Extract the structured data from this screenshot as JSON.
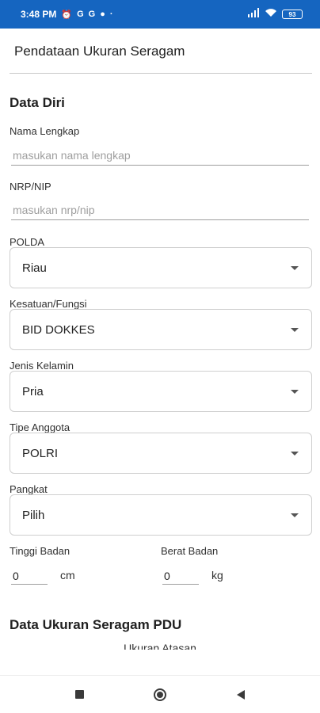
{
  "status_bar": {
    "time": "3:48 PM",
    "notification_icons": [
      "alarm-icon",
      "google-icon",
      "google-icon",
      "app-icon"
    ],
    "notification_glyphs": [
      "⏰",
      "G",
      "G",
      "●"
    ],
    "dot": "·",
    "battery": "93"
  },
  "app_bar": {
    "title": "Pendataan Ukuran Seragam"
  },
  "form": {
    "section_personal": "Data Diri",
    "nama": {
      "label": "Nama Lengkap",
      "placeholder": "masukan nama lengkap",
      "value": ""
    },
    "nrp": {
      "label": "NRP/NIP",
      "placeholder": "masukan nrp/nip",
      "value": ""
    },
    "polda": {
      "label": "POLDA",
      "value": "Riau"
    },
    "kesatuan": {
      "label": "Kesatuan/Fungsi",
      "value": "BID DOKKES"
    },
    "jenis_kelamin": {
      "label": "Jenis Kelamin",
      "value": "Pria"
    },
    "tipe_anggota": {
      "label": "Tipe Anggota",
      "value": "POLRI"
    },
    "pangkat": {
      "label": "Pangkat",
      "value": "Pilih"
    },
    "tinggi": {
      "label": "Tinggi Badan",
      "value": "0",
      "unit": "cm"
    },
    "berat": {
      "label": "Berat Badan",
      "value": "0",
      "unit": "kg"
    },
    "section_pdu": "Data Ukuran Seragam PDU",
    "ukuran_atasan": "Ukuran Atasan"
  },
  "colors": {
    "status_bar": "#1565c0",
    "background": "#ffffff"
  },
  "nav_bar": {
    "icons": [
      "recents-square-icon",
      "home-circle-icon",
      "back-triangle-icon"
    ]
  }
}
